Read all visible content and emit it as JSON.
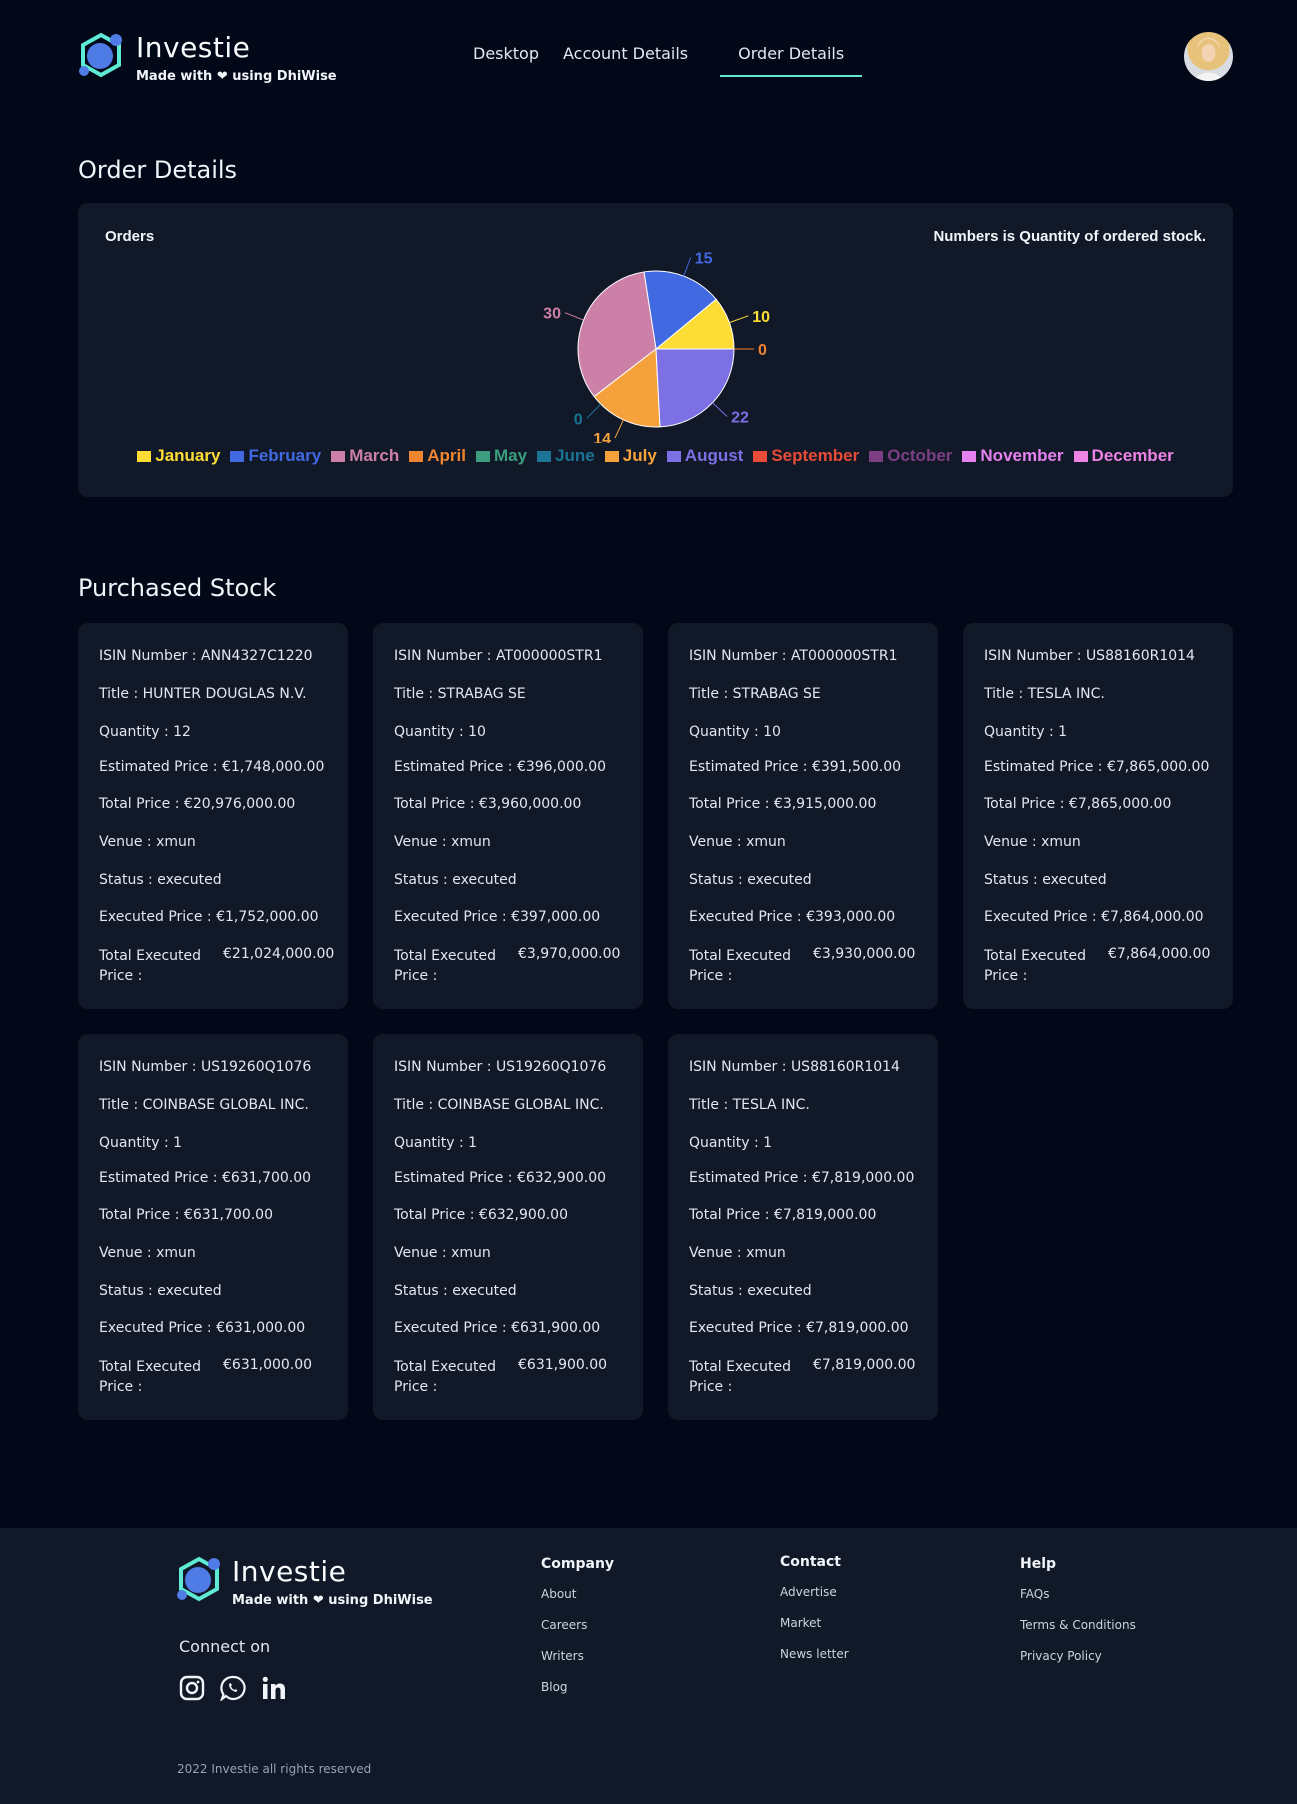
{
  "brand": {
    "name": "Investie",
    "tagline": "Made with ❤ using DhiWise"
  },
  "nav": [
    {
      "label": "Desktop",
      "active": false
    },
    {
      "label": "Account Details",
      "active": false
    },
    {
      "label": "Order Details",
      "active": true
    }
  ],
  "order_details": {
    "title": "Order Details",
    "left_label": "Orders",
    "right_label": "Numbers is Quantity of ordered stock."
  },
  "chart_data": {
    "type": "pie",
    "title": "",
    "categories": [
      "January",
      "February",
      "March",
      "April",
      "May",
      "June",
      "July",
      "August",
      "September",
      "October",
      "November",
      "December"
    ],
    "values": [
      10,
      15,
      30,
      0,
      0,
      0,
      14,
      22,
      0,
      0,
      0,
      0
    ],
    "shown_labels": [
      "15",
      "10",
      "0",
      "30",
      "0",
      "14",
      "22"
    ],
    "colors": [
      "#fddd35",
      "#4169e1",
      "#cc80a8",
      "#f08530",
      "#3c9e7f",
      "#1b7496",
      "#f5a23c",
      "#7c70e4",
      "#e84b37",
      "#7d3f84",
      "#e681f0",
      "#ee83e6"
    ],
    "legend_placement": "bottom"
  },
  "purchased": {
    "title": "Purchased Stock",
    "labels": {
      "isin": "ISIN Number :",
      "title": "Title :",
      "quantity": "Quantity :",
      "est_price": "Estimated Price :",
      "total_price": "Total Price :",
      "venue": "Venue :",
      "status": "Status :",
      "exec_price": "Executed Price :",
      "total_exec": "Total Executed Price :"
    },
    "stocks": [
      {
        "isin": "ANN4327C1220",
        "title": "HUNTER DOUGLAS N.V.",
        "quantity": "12",
        "est_price": "€1,748,000.00",
        "total_price": "€20,976,000.00",
        "venue": "xmun",
        "status": "executed",
        "exec_price": "€1,752,000.00",
        "total_exec": "€21,024,000.00"
      },
      {
        "isin": "AT000000STR1",
        "title": "STRABAG SE",
        "quantity": "10",
        "est_price": "€396,000.00",
        "total_price": "€3,960,000.00",
        "venue": "xmun",
        "status": "executed",
        "exec_price": "€397,000.00",
        "total_exec": "€3,970,000.00"
      },
      {
        "isin": "AT000000STR1",
        "title": "STRABAG SE",
        "quantity": "10",
        "est_price": "€391,500.00",
        "total_price": "€3,915,000.00",
        "venue": "xmun",
        "status": "executed",
        "exec_price": "€393,000.00",
        "total_exec": "€3,930,000.00"
      },
      {
        "isin": "US88160R1014",
        "title": "TESLA INC.",
        "quantity": "1",
        "est_price": "€7,865,000.00",
        "total_price": "€7,865,000.00",
        "venue": "xmun",
        "status": "executed",
        "exec_price": "€7,864,000.00",
        "total_exec": "€7,864,000.00"
      },
      {
        "isin": "US19260Q1076",
        "title": "COINBASE GLOBAL INC.",
        "quantity": "1",
        "est_price": "€631,700.00",
        "total_price": "€631,700.00",
        "venue": "xmun",
        "status": "executed",
        "exec_price": "€631,000.00",
        "total_exec": "€631,000.00"
      },
      {
        "isin": "US19260Q1076",
        "title": "COINBASE GLOBAL INC.",
        "quantity": "1",
        "est_price": "€632,900.00",
        "total_price": "€632,900.00",
        "venue": "xmun",
        "status": "executed",
        "exec_price": "€631,900.00",
        "total_exec": "€631,900.00"
      },
      {
        "isin": "US88160R1014",
        "title": "TESLA INC.",
        "quantity": "1",
        "est_price": "€7,819,000.00",
        "total_price": "€7,819,000.00",
        "venue": "xmun",
        "status": "executed",
        "exec_price": "€7,819,000.00",
        "total_exec": "€7,819,000.00"
      }
    ]
  },
  "footer": {
    "connect": "Connect on",
    "socials": [
      "instagram-icon",
      "whatsapp-icon",
      "linkedin-icon"
    ],
    "columns": [
      {
        "heading": "Company",
        "links": [
          "About",
          "Careers",
          "Writers",
          "Blog"
        ]
      },
      {
        "heading": "Contact",
        "links": [
          "Advertise",
          "Market",
          "News letter"
        ]
      },
      {
        "heading": "Help",
        "links": [
          "FAQs",
          "Terms & Conditions",
          "Privacy Policy"
        ]
      }
    ],
    "copyright": "2022 Investie all rights reserved"
  }
}
